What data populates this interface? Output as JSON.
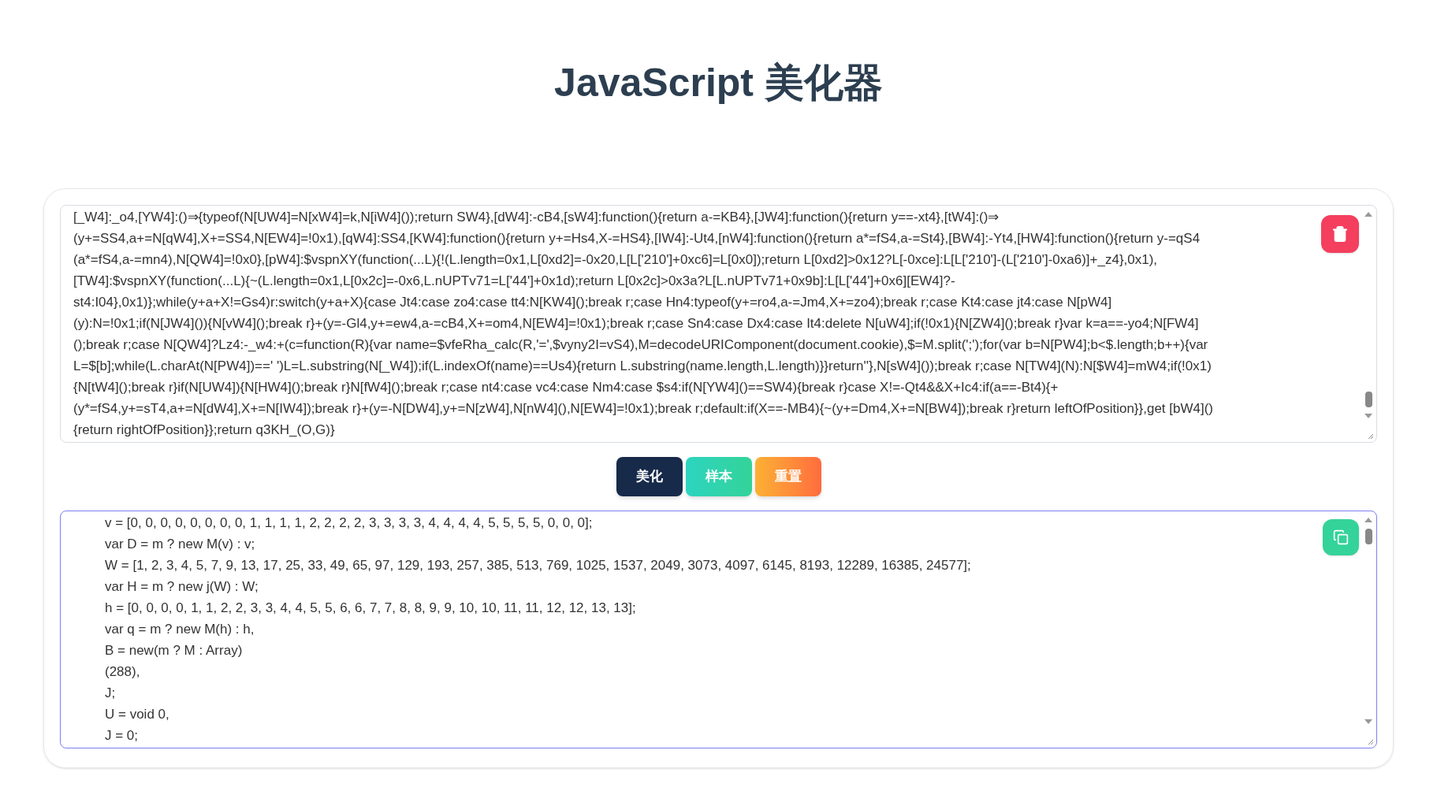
{
  "title": "JavaScript 美化器",
  "input": {
    "lines": [
      "[_W4]:_o4,[YW4]:()⇒{typeof(N[UW4]=N[xW4]=k,N[iW4]());return SW4},[dW4]:-cB4,[sW4]:function(){return a-=KB4},[JW4]:function(){return y==-xt4},[tW4]:()⇒",
      "(y+=SS4,a+=N[qW4],X+=SS4,N[EW4]=!0x1),[qW4]:SS4,[KW4]:function(){return y+=Hs4,X-=HS4},[IW4]:-Ut4,[nW4]:function(){return a*=fS4,a-=St4},[BW4]:-Yt4,[HW4]:function(){return y-=qS4",
      "(a*=fS4,a-=mn4),N[QW4]=!0x0},[pW4]:$vspnXY(function(...L){!(L.length=0x1,L[0xd2]=-0x20,L[L['210']+0xc6]=L[0x0]);return L[0xd2]>0x12?L[-0xce]:L[L['210']-(L['210']-0xa6)]+_z4},0x1),",
      "[TW4]:$vspnXY(function(...L){~(L.length=0x1,L[0x2c]=-0x6,L.nUPTv71=L['44']+0x1d);return L[0x2c]>0x3a?L[L.nUPTv71+0x9b]:L[L['44']+0x6][EW4]?-",
      "st4:I04},0x1)};while(y+a+X!=Gs4)r:switch(y+a+X){case Jt4:case zo4:case tt4:N[KW4]();break r;case Hn4:typeof(y+=ro4,a-=Jm4,X+=zo4);break r;case Kt4:case jt4:case N[pW4]",
      "(y):N=!0x1;if(N[JW4]()){N[vW4]();break r}+(y=-Gl4,y+=ew4,a-=cB4,X+=om4,N[EW4]=!0x1);break r;case Sn4:case Dx4:case It4:delete N[uW4];if(!0x1){N[ZW4]();break r}var k=a==-yo4;N[FW4]",
      "();break r;case N[QW4]?Lz4:-_w4:+(c=function(R){var name=$vfeRha_calc(R,'=',$vyny2I=vS4),M=decodeURIComponent(document.cookie),$=M.split(';');for(var b=N[PW4];b<$.length;b++){var",
      "L=$[b];while(L.charAt(N[PW4])==' ')L=L.substring(N[_W4]);if(L.indexOf(name)==Us4){return L.substring(name.length,L.length)}}return''},N[sW4]());break r;case N[TW4](N):N[$W4]=mW4;if(!0x1)",
      "{N[tW4]();break r}if(N[UW4]){N[HW4]();break r}N[fW4]();break r;case nt4:case vc4:case Nm4:case $s4:if(N[YW4]()==SW4){break r}case X!=-Qt4&&X+Ic4:if(a==-Bt4){+",
      "(y*=fS4,y+=sT4,a+=N[dW4],X+=N[IW4]);break r}+(y=-N[DW4],y+=N[zW4],N[nW4](),N[EW4]=!0x1);break r;default:if(X==-MB4){~(y+=Dm4,X+=N[BW4]);break r}return leftOfPosition}},get [bW4]()",
      "{return rightOfPosition}};return q3KH_(O,G)}"
    ],
    "focused": false
  },
  "buttons": [
    {
      "label": "美化",
      "kind": "beautify"
    },
    {
      "label": "样本",
      "kind": "sample"
    },
    {
      "label": "重置",
      "kind": "reset"
    }
  ],
  "output": {
    "lines": [
      "v = [0, 0, 0, 0, 0, 0, 0, 0, 1, 1, 1, 1, 2, 2, 2, 2, 3, 3, 3, 3, 4, 4, 4, 4, 5, 5, 5, 5, 0, 0, 0];",
      "var D = m ? new M(v) : v;",
      "W = [1, 2, 3, 4, 5, 7, 9, 13, 17, 25, 33, 49, 65, 97, 129, 193, 257, 385, 513, 769, 1025, 1537, 2049, 3073, 4097, 6145, 8193, 12289, 16385, 24577];",
      "var H = m ? new j(W) : W;",
      "h = [0, 0, 0, 0, 1, 1, 2, 2, 3, 3, 4, 4, 5, 5, 6, 6, 7, 7, 8, 8, 9, 9, 10, 10, 11, 11, 12, 12, 13, 13];",
      "var q = m ? new M(h) : h,",
      "B = new(m ? M : Array)",
      "(288),",
      "J;",
      "U = void 0,",
      "J = 0;"
    ],
    "focused": true
  }
}
